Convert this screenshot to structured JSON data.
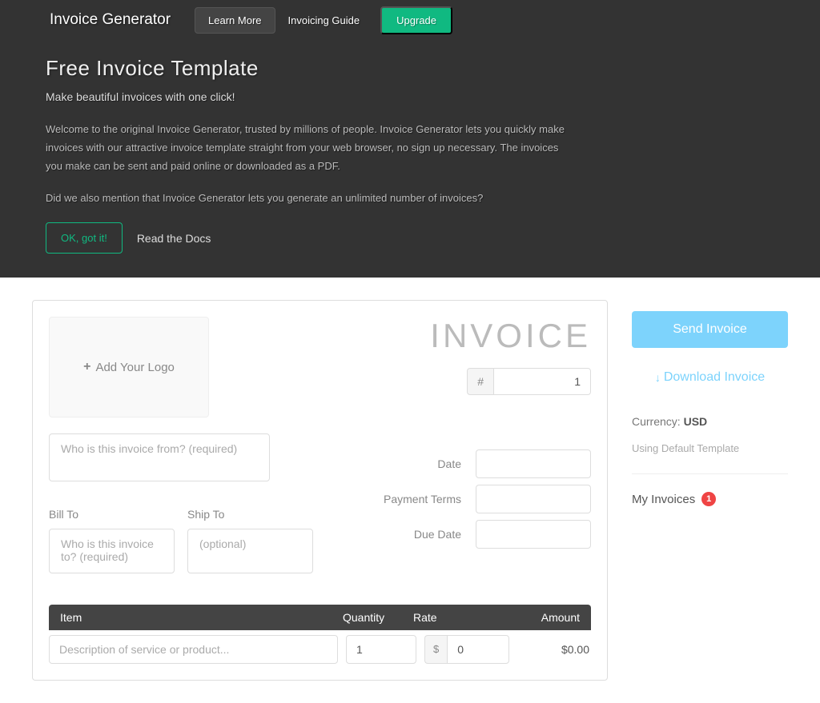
{
  "navbar": {
    "brand": "Invoice Generator",
    "learn_more": "Learn More",
    "invoicing_guide": "Invoicing Guide",
    "upgrade": "Upgrade"
  },
  "hero": {
    "title": "Free Invoice Template",
    "subtitle": "Make beautiful invoices with one click!",
    "para1": "Welcome to the original Invoice Generator, trusted by millions of people. Invoice Generator lets you quickly make invoices with our attractive invoice template straight from your web browser, no sign up necessary. The invoices you make can be sent and paid online or downloaded as a PDF.",
    "para2": "Did we also mention that Invoice Generator lets you generate an unlimited number of invoices?",
    "ok_button": "OK, got it!",
    "docs_link": "Read the Docs"
  },
  "invoice": {
    "add_logo": "Add Your Logo",
    "heading": "INVOICE",
    "hash": "#",
    "number": "1",
    "from_placeholder": "Who is this invoice from? (required)",
    "bill_to_label": "Bill To",
    "bill_to_placeholder": "Who is this invoice to? (required)",
    "ship_to_label": "Ship To",
    "ship_to_placeholder": "(optional)",
    "date_label": "Date",
    "payment_terms_label": "Payment Terms",
    "due_date_label": "Due Date",
    "columns": {
      "item": "Item",
      "quantity": "Quantity",
      "rate": "Rate",
      "amount": "Amount"
    },
    "line": {
      "desc_placeholder": "Description of service or product...",
      "qty": "1",
      "rate_prefix": "$",
      "rate": "0",
      "amount": "$0.00"
    }
  },
  "sidebar": {
    "send": "Send Invoice",
    "download": "Download Invoice",
    "currency_label": "Currency: ",
    "currency_value": "USD",
    "template_text": "Using Default Template",
    "my_invoices": "My Invoices",
    "count": "1"
  }
}
